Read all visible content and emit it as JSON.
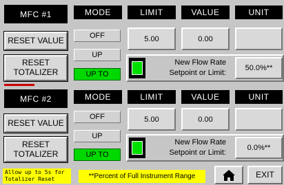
{
  "headers": {
    "mode": "MODE",
    "limit": "LIMIT",
    "value": "VALUE",
    "unit": "UNIT"
  },
  "mfc1": {
    "title": "MFC #1",
    "reset_value": "RESET VALUE",
    "reset_totalizer_line1": "RESET",
    "reset_totalizer_line2": "TOTALIZER",
    "mode_off": "OFF",
    "mode_up": "UP",
    "mode_up_to": "UP TO",
    "limit": "5.00",
    "value": "0.00",
    "unit": "",
    "setpoint_line1": "New Flow Rate",
    "setpoint_line2": "Setpoint or Limit:",
    "setpoint_value": "50.0%**"
  },
  "mfc2": {
    "title": "MFC #2",
    "reset_value": "RESET VALUE",
    "reset_totalizer_line1": "RESET",
    "reset_totalizer_line2": "TOTALIZER",
    "mode_off": "OFF",
    "mode_up": "UP",
    "mode_up_to": "UP TO",
    "limit": "5.00",
    "value": "0.00",
    "unit": "",
    "setpoint_line1": "New Flow Rate",
    "setpoint_line2": "Setpoint or Limit:",
    "setpoint_value": "0.0%**"
  },
  "footer": {
    "note_line1": "Allow up to 5s for",
    "note_line2": "Totalizer Reset",
    "percent_note": "**Percent of Full Instrument Range",
    "home_icon": "home-icon",
    "exit_label": "EXIT"
  },
  "colors": {
    "active_mode": "#00d800",
    "indicator": "#00e000",
    "note_bg": "#ffff00"
  }
}
